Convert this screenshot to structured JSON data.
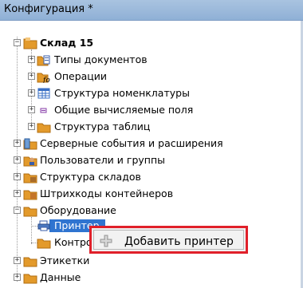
{
  "window": {
    "title": "Конфигурация *"
  },
  "tree": {
    "root": {
      "label": "Склад 15"
    },
    "root_children": [
      {
        "label": "Типы документов"
      },
      {
        "label": "Операции"
      },
      {
        "label": "Структура номенклатуры"
      },
      {
        "label": "Общие вычисляемые поля"
      },
      {
        "label": "Структура таблиц"
      }
    ],
    "sections": [
      {
        "label": "Серверные события и расширения"
      },
      {
        "label": "Пользователи и группы"
      },
      {
        "label": "Структура складов"
      },
      {
        "label": "Штрихкоды контейнеров"
      },
      {
        "label": "Оборудование"
      }
    ],
    "equipment_children": [
      {
        "label": "Принтер"
      },
      {
        "label": "Контрол"
      }
    ],
    "after": [
      {
        "label": "Этикетки"
      },
      {
        "label": "Данные"
      }
    ]
  },
  "context_menu": {
    "add_printer_label": "Добавить принтер"
  },
  "icons": {
    "folder": "folder-icon",
    "document": "document-icon",
    "operation": "operation-icon",
    "table": "table-icon",
    "field": "field-icon",
    "printer": "printer-icon",
    "plus": "plus-icon"
  },
  "colors": {
    "selection": "#2f74d0",
    "highlight_border": "#e0202a",
    "folder": "#e39a2b"
  }
}
